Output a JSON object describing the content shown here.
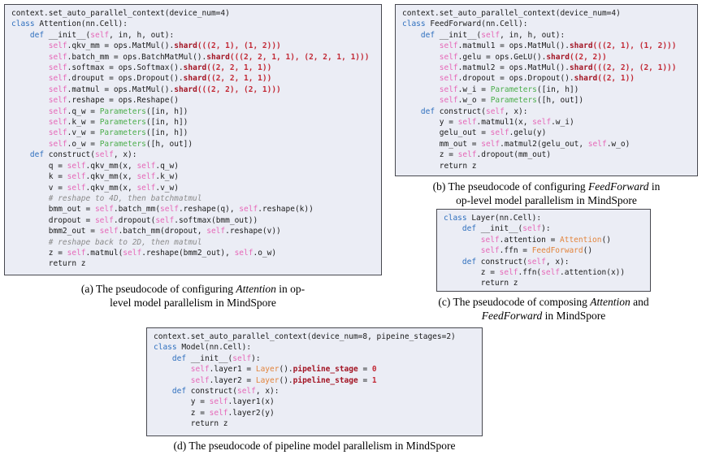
{
  "figure": {
    "description_colors": {
      "panel_background": "#ebedf5",
      "panel_border": "#47484f",
      "keyword_blue": "#2e6fbe",
      "self_pink": "#e668b8",
      "shard_dark_red": "#a31524",
      "tuple_red": "#c22a36",
      "parameters_green": "#4cae4c",
      "class_ref_orange": "#e2843c",
      "comment_gray": "#8a8a8a",
      "plain_text": "#1a1a1a"
    }
  },
  "panels": {
    "a": {
      "code": [
        [
          [
            "p",
            "context.set_auto_parallel_context(device_num=4)"
          ]
        ],
        [
          [
            "k",
            "class"
          ],
          [
            "p",
            " Attention(nn.Cell):"
          ]
        ],
        [
          [
            "p",
            "    "
          ],
          [
            "k",
            "def"
          ],
          [
            "p",
            " __init__("
          ],
          [
            "s",
            "self"
          ],
          [
            "p",
            ", in, h, out):"
          ]
        ],
        [
          [
            "p",
            "        "
          ],
          [
            "s",
            "self"
          ],
          [
            "p",
            ".qkv_mm = ops.MatMul()."
          ],
          [
            "h",
            "shard"
          ],
          [
            "n",
            "(((2, 1), (1, 2)))"
          ]
        ],
        [
          [
            "p",
            "        "
          ],
          [
            "s",
            "self"
          ],
          [
            "p",
            ".batch_mm = ops.BatchMatMul()."
          ],
          [
            "h",
            "shard"
          ],
          [
            "n",
            "(((2, 2, 1, 1), (2, 2, 1, 1)))"
          ]
        ],
        [
          [
            "p",
            "        "
          ],
          [
            "s",
            "self"
          ],
          [
            "p",
            ".softmax = ops.Softmax()."
          ],
          [
            "h",
            "shard"
          ],
          [
            "n",
            "((2, 2, 1, 1))"
          ]
        ],
        [
          [
            "p",
            "        "
          ],
          [
            "s",
            "self"
          ],
          [
            "p",
            ".drouput = ops.Dropout()."
          ],
          [
            "h",
            "shard"
          ],
          [
            "n",
            "((2, 2, 1, 1))"
          ]
        ],
        [
          [
            "p",
            "        "
          ],
          [
            "s",
            "self"
          ],
          [
            "p",
            ".matmul = ops.MatMul()."
          ],
          [
            "h",
            "shard"
          ],
          [
            "n",
            "(((2, 2), (2, 1)))"
          ]
        ],
        [
          [
            "p",
            "        "
          ],
          [
            "s",
            "self"
          ],
          [
            "p",
            ".reshape = ops.Reshape()"
          ]
        ],
        [
          [
            "p",
            "        "
          ],
          [
            "s",
            "self"
          ],
          [
            "p",
            ".q_w = "
          ],
          [
            "g",
            "Parameters"
          ],
          [
            "p",
            "([in, h])"
          ]
        ],
        [
          [
            "p",
            "        "
          ],
          [
            "s",
            "self"
          ],
          [
            "p",
            ".k_w = "
          ],
          [
            "g",
            "Parameters"
          ],
          [
            "p",
            "([in, h])"
          ]
        ],
        [
          [
            "p",
            "        "
          ],
          [
            "s",
            "self"
          ],
          [
            "p",
            ".v_w = "
          ],
          [
            "g",
            "Parameters"
          ],
          [
            "p",
            "([in, h])"
          ]
        ],
        [
          [
            "p",
            "        "
          ],
          [
            "s",
            "self"
          ],
          [
            "p",
            ".o_w = "
          ],
          [
            "g",
            "Parameters"
          ],
          [
            "p",
            "([h, out])"
          ]
        ],
        [
          [
            "p",
            "    "
          ],
          [
            "k",
            "def"
          ],
          [
            "p",
            " construct("
          ],
          [
            "s",
            "self"
          ],
          [
            "p",
            ", x):"
          ]
        ],
        [
          [
            "p",
            "        q = "
          ],
          [
            "s",
            "self"
          ],
          [
            "p",
            ".qkv_mm(x, "
          ],
          [
            "s",
            "self"
          ],
          [
            "p",
            ".q_w)"
          ]
        ],
        [
          [
            "p",
            "        k = "
          ],
          [
            "s",
            "self"
          ],
          [
            "p",
            ".qkv_mm(x, "
          ],
          [
            "s",
            "self"
          ],
          [
            "p",
            ".k_w)"
          ]
        ],
        [
          [
            "p",
            "        v = "
          ],
          [
            "s",
            "self"
          ],
          [
            "p",
            ".qkv_mm(x, "
          ],
          [
            "s",
            "self"
          ],
          [
            "p",
            ".v_w)"
          ]
        ],
        [
          [
            "c",
            "        # reshape to 4D, then batchmatmul"
          ]
        ],
        [
          [
            "p",
            "        bmm_out = "
          ],
          [
            "s",
            "self"
          ],
          [
            "p",
            ".batch_mm("
          ],
          [
            "s",
            "self"
          ],
          [
            "p",
            ".reshape(q), "
          ],
          [
            "s",
            "self"
          ],
          [
            "p",
            ".reshape(k))"
          ]
        ],
        [
          [
            "p",
            "        dropout = "
          ],
          [
            "s",
            "self"
          ],
          [
            "p",
            ".dropout("
          ],
          [
            "s",
            "self"
          ],
          [
            "p",
            ".softmax(bmm_out))"
          ]
        ],
        [
          [
            "p",
            "        bmm2_out = "
          ],
          [
            "s",
            "self"
          ],
          [
            "p",
            ".batch_mm(dropout, "
          ],
          [
            "s",
            "self"
          ],
          [
            "p",
            ".reshape(v))"
          ]
        ],
        [
          [
            "c",
            "        # reshape back to 2D, then matmul"
          ]
        ],
        [
          [
            "p",
            "        z = "
          ],
          [
            "s",
            "self"
          ],
          [
            "p",
            ".matmul("
          ],
          [
            "s",
            "self"
          ],
          [
            "p",
            ".reshape(bmm2_out), "
          ],
          [
            "s",
            "self"
          ],
          [
            "p",
            ".o_w)"
          ]
        ],
        [
          [
            "p",
            "        return z"
          ]
        ]
      ],
      "caption": [
        [
          [
            "r",
            "(a) The pseudocode of configuring "
          ],
          [
            "i",
            "Attention"
          ],
          [
            "r",
            " in op-"
          ]
        ],
        [
          [
            "r",
            "level model parallelism in MindSpore"
          ]
        ]
      ]
    },
    "b": {
      "code": [
        [
          [
            "p",
            "context.set_auto_parallel_context(device_num=4)"
          ]
        ],
        [
          [
            "k",
            "class"
          ],
          [
            "p",
            " FeedForward(nn.Cell):"
          ]
        ],
        [
          [
            "p",
            "    "
          ],
          [
            "k",
            "def"
          ],
          [
            "p",
            " __init__("
          ],
          [
            "s",
            "self"
          ],
          [
            "p",
            ", in, h, out):"
          ]
        ],
        [
          [
            "p",
            "        "
          ],
          [
            "s",
            "self"
          ],
          [
            "p",
            ".matmul1 = ops.MatMul()."
          ],
          [
            "h",
            "shard"
          ],
          [
            "n",
            "(((2, 1), (1, 2)))"
          ]
        ],
        [
          [
            "p",
            "        "
          ],
          [
            "s",
            "self"
          ],
          [
            "p",
            ".gelu = ops.GeLU()."
          ],
          [
            "h",
            "shard"
          ],
          [
            "n",
            "((2, 2))"
          ]
        ],
        [
          [
            "p",
            "        "
          ],
          [
            "s",
            "self"
          ],
          [
            "p",
            ".matmul2 = ops.MatMul()."
          ],
          [
            "h",
            "shard"
          ],
          [
            "n",
            "(((2, 2), (2, 1)))"
          ]
        ],
        [
          [
            "p",
            "        "
          ],
          [
            "s",
            "self"
          ],
          [
            "p",
            ".dropout = ops.Dropout()."
          ],
          [
            "h",
            "shard"
          ],
          [
            "n",
            "((2, 1))"
          ]
        ],
        [
          [
            "p",
            "        "
          ],
          [
            "s",
            "self"
          ],
          [
            "p",
            ".w_i = "
          ],
          [
            "g",
            "Parameters"
          ],
          [
            "p",
            "([in, h])"
          ]
        ],
        [
          [
            "p",
            "        "
          ],
          [
            "s",
            "self"
          ],
          [
            "p",
            ".w_o = "
          ],
          [
            "g",
            "Parameters"
          ],
          [
            "p",
            "([h, out])"
          ]
        ],
        [
          [
            "p",
            "    "
          ],
          [
            "k",
            "def"
          ],
          [
            "p",
            " construct("
          ],
          [
            "s",
            "self"
          ],
          [
            "p",
            ", x):"
          ]
        ],
        [
          [
            "p",
            "        y = "
          ],
          [
            "s",
            "self"
          ],
          [
            "p",
            ".matmul1(x, "
          ],
          [
            "s",
            "self"
          ],
          [
            "p",
            ".w_i)"
          ]
        ],
        [
          [
            "p",
            "        gelu_out = "
          ],
          [
            "s",
            "self"
          ],
          [
            "p",
            ".gelu(y)"
          ]
        ],
        [
          [
            "p",
            "        mm_out = "
          ],
          [
            "s",
            "self"
          ],
          [
            "p",
            ".matmul2(gelu_out, "
          ],
          [
            "s",
            "self"
          ],
          [
            "p",
            ".w_o)"
          ]
        ],
        [
          [
            "p",
            "        z = "
          ],
          [
            "s",
            "self"
          ],
          [
            "p",
            ".dropout(mm_out)"
          ]
        ],
        [
          [
            "p",
            "        return z"
          ]
        ]
      ],
      "caption": [
        [
          [
            "r",
            "(b) The pseudocode of configuring "
          ],
          [
            "i",
            "FeedForward"
          ],
          [
            "r",
            " in"
          ]
        ],
        [
          [
            "r",
            "op-level model parallelism in MindSpore"
          ]
        ]
      ]
    },
    "c": {
      "code": [
        [
          [
            "k",
            "class"
          ],
          [
            "p",
            " Layer(nn.Cell):"
          ]
        ],
        [
          [
            "p",
            "    "
          ],
          [
            "k",
            "def"
          ],
          [
            "p",
            " __init__("
          ],
          [
            "s",
            "self"
          ],
          [
            "p",
            "):"
          ]
        ],
        [
          [
            "p",
            "        "
          ],
          [
            "s",
            "self"
          ],
          [
            "p",
            ".attention = "
          ],
          [
            "o",
            "Attention"
          ],
          [
            "p",
            "()"
          ]
        ],
        [
          [
            "p",
            "        "
          ],
          [
            "s",
            "self"
          ],
          [
            "p",
            ".ffn = "
          ],
          [
            "o",
            "FeedForward"
          ],
          [
            "p",
            "()"
          ]
        ],
        [
          [
            "p",
            "    "
          ],
          [
            "k",
            "def"
          ],
          [
            "p",
            " construct("
          ],
          [
            "s",
            "self"
          ],
          [
            "p",
            ", x):"
          ]
        ],
        [
          [
            "p",
            "        z = "
          ],
          [
            "s",
            "self"
          ],
          [
            "p",
            ".ffn("
          ],
          [
            "s",
            "self"
          ],
          [
            "p",
            ".attention(x))"
          ]
        ],
        [
          [
            "p",
            "        return z"
          ]
        ]
      ],
      "caption": [
        [
          [
            "r",
            "(c) The pseudocode of composing "
          ],
          [
            "i",
            "Attention"
          ],
          [
            "r",
            " and"
          ]
        ],
        [
          [
            "i",
            "FeedForward"
          ],
          [
            "r",
            " in MindSpore"
          ]
        ]
      ]
    },
    "d": {
      "code": [
        [
          [
            "p",
            "context.set_auto_parallel_context(device_num=8, pipeine_stages=2)"
          ]
        ],
        [
          [
            "k",
            "class"
          ],
          [
            "p",
            " Model(nn.Cell):"
          ]
        ],
        [
          [
            "p",
            "    "
          ],
          [
            "k",
            "def"
          ],
          [
            "p",
            " __init__("
          ],
          [
            "s",
            "self"
          ],
          [
            "p",
            "):"
          ]
        ],
        [
          [
            "p",
            "        "
          ],
          [
            "s",
            "self"
          ],
          [
            "p",
            ".layer1 = "
          ],
          [
            "o",
            "Layer"
          ],
          [
            "p",
            "()."
          ],
          [
            "h",
            "pipeline_stage"
          ],
          [
            "p",
            " = "
          ],
          [
            "n",
            "0"
          ]
        ],
        [
          [
            "p",
            "        "
          ],
          [
            "s",
            "self"
          ],
          [
            "p",
            ".layer2 = "
          ],
          [
            "o",
            "Layer"
          ],
          [
            "p",
            "()."
          ],
          [
            "h",
            "pipeline_stage"
          ],
          [
            "p",
            " = "
          ],
          [
            "n",
            "1"
          ]
        ],
        [
          [
            "p",
            "    "
          ],
          [
            "k",
            "def"
          ],
          [
            "p",
            " construct("
          ],
          [
            "s",
            "self"
          ],
          [
            "p",
            ", x):"
          ]
        ],
        [
          [
            "p",
            "        y = "
          ],
          [
            "s",
            "self"
          ],
          [
            "p",
            ".layer1(x)"
          ]
        ],
        [
          [
            "p",
            "        z = "
          ],
          [
            "s",
            "self"
          ],
          [
            "p",
            ".layer2(y)"
          ]
        ],
        [
          [
            "p",
            "        return z"
          ]
        ]
      ],
      "caption": [
        [
          [
            "r",
            "(d) The pseudocode of pipeline model parallelism in MindSpore"
          ]
        ]
      ]
    }
  }
}
